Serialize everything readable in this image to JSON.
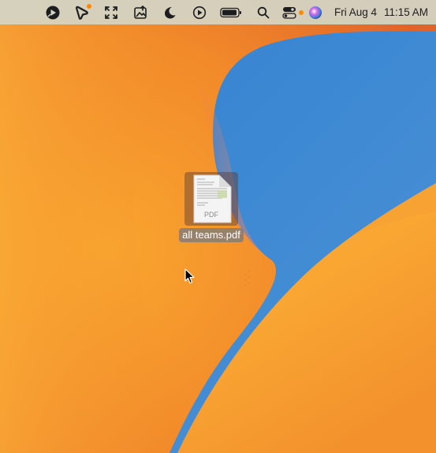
{
  "menubar": {
    "icons": [
      "screencast-app-icon",
      "cursor-badge-icon",
      "fullscreen-arrows-icon",
      "image-upload-icon",
      "moon-icon",
      "play-circle-icon",
      "battery-icon",
      "search-icon",
      "control-center-icon",
      "siri-icon"
    ],
    "date": "Fri Aug 4",
    "time": "11:15 AM"
  },
  "desktop": {
    "file": {
      "name": "all teams.pdf",
      "type_label": "PDF",
      "icon": "pdf-document-icon"
    }
  },
  "colors": {
    "accent_orange": "#ff8a00",
    "wallpaper_blue": "#3a86cf",
    "wallpaper_orange": "#f79a2a"
  }
}
